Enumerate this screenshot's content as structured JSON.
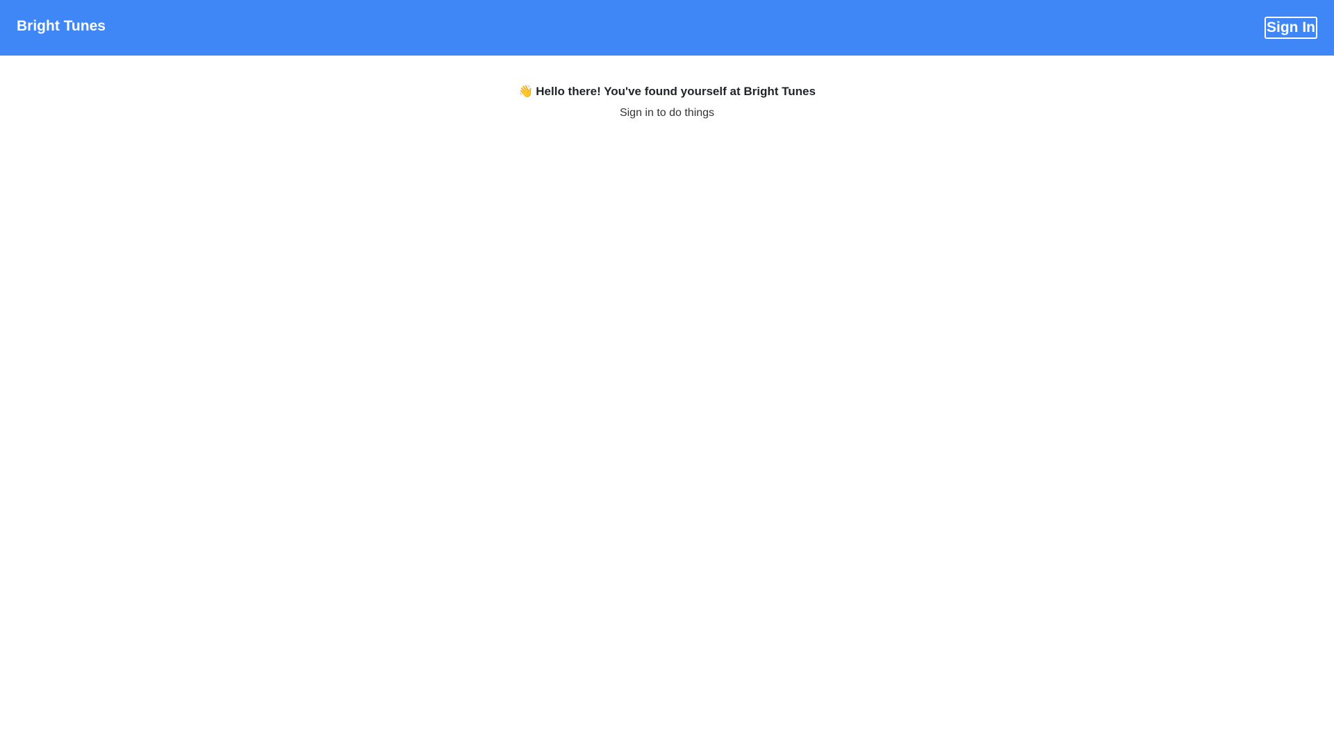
{
  "header": {
    "brand": "Bright Tunes",
    "signin_label": "Sign In",
    "background_color": "#3f87f6"
  },
  "main": {
    "welcome_icon": "waving-hand-icon",
    "welcome_icon_glyph": "👋",
    "welcome_text": "Hello there! You've found yourself at Bright Tunes",
    "subtitle": "Sign in to do things"
  }
}
